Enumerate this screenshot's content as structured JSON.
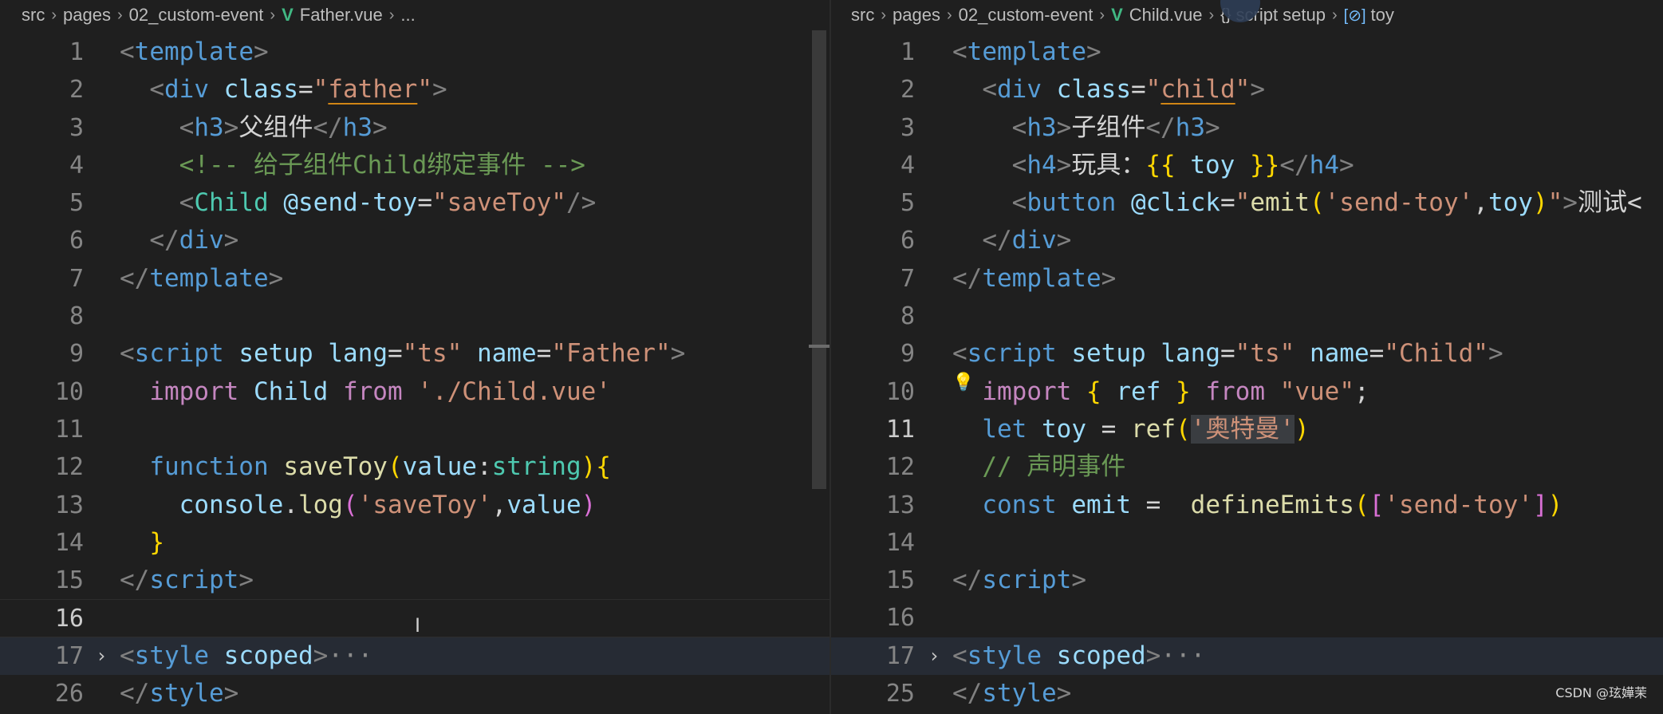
{
  "left_editor": {
    "breadcrumb": [
      "src",
      "pages",
      "02_custom-event",
      "Father.vue",
      "..."
    ],
    "line_numbers": [
      "1",
      "2",
      "3",
      "4",
      "5",
      "6",
      "7",
      "8",
      "9",
      "10",
      "11",
      "12",
      "13",
      "14",
      "15",
      "16",
      "17",
      "26"
    ],
    "text": {
      "l3": "父组件",
      "l4": "<!-- 给子组件Child绑定事件 -->",
      "l5_value": "\"saveToy\"",
      "l9_lang": "\"ts\"",
      "l9_name": "\"Father\"",
      "l10_path": "'./Child.vue'",
      "l13_str": "'saveToy'"
    }
  },
  "right_editor": {
    "breadcrumb": [
      "src",
      "pages",
      "02_custom-event",
      "Child.vue",
      "script setup",
      "toy"
    ],
    "line_numbers": [
      "1",
      "2",
      "3",
      "4",
      "5",
      "6",
      "7",
      "8",
      "9",
      "10",
      "11",
      "12",
      "13",
      "14",
      "15",
      "16",
      "17",
      "25"
    ],
    "text": {
      "l3": "子组件",
      "l4": "玩具：",
      "l5_str": "'send-toy'",
      "l5_tail": "测试<",
      "l9_lang": "\"ts\"",
      "l9_name": "\"Child\"",
      "l10_from": "\"vue\"",
      "l11_str": "'奥特曼'",
      "l12_comment": "// 声明事件",
      "l13_str": "'send-toy'"
    }
  },
  "icons": {
    "vue": "vue-file-icon",
    "braces": "code-braces-icon",
    "symbol": "variable-symbol-icon",
    "lightbulb": "lightbulb-icon",
    "fold": "chevron-right-icon"
  },
  "watermark": "CSDN @玹嬅茉"
}
